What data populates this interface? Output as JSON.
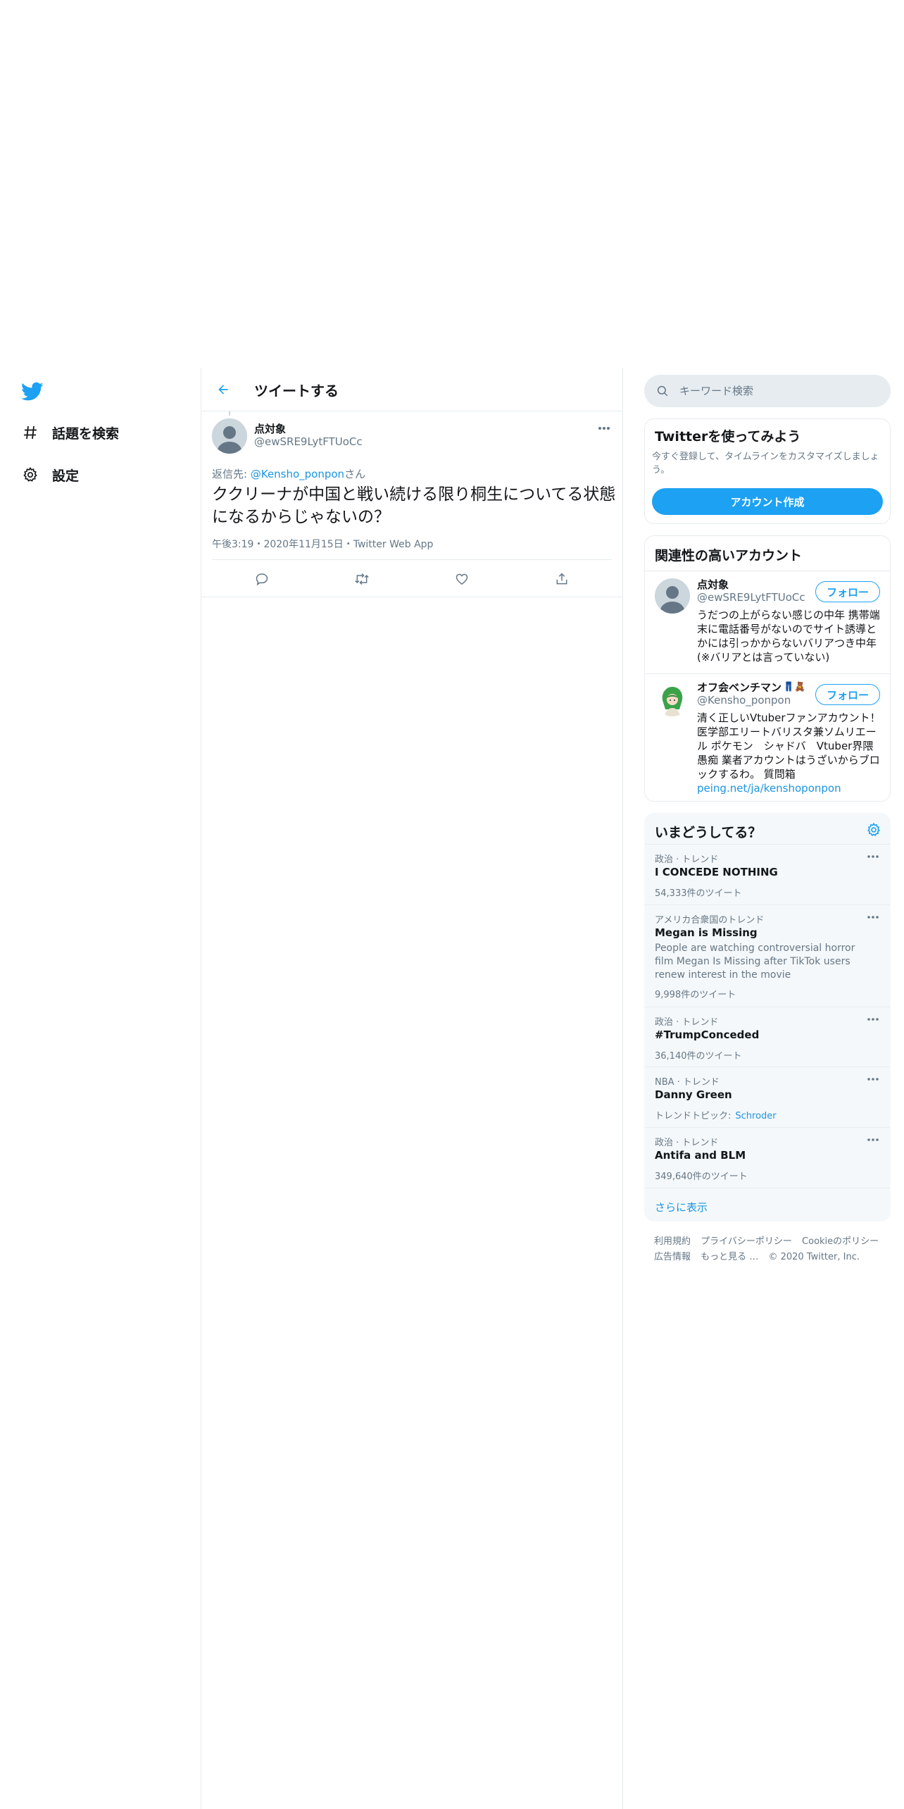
{
  "nav": {
    "items": [
      {
        "label": "話題を検索",
        "icon": "hashtag-icon"
      },
      {
        "label": "設定",
        "icon": "gear-icon"
      }
    ]
  },
  "header": {
    "title": "ツイートする"
  },
  "tweet": {
    "name": "点対象",
    "handle": "@ewSRE9LytFTUoCc",
    "reply_prefix": "返信先: ",
    "reply_mention": "@Kensho_ponpon",
    "reply_suffix": "さん",
    "text": "ククリーナが中国と戦い続ける限り桐生についてる状態になるからじゃないの？",
    "time": "午後3:19",
    "date": "2020年11月15日",
    "app": "Twitter Web App",
    "separator": "・"
  },
  "search": {
    "placeholder": "キーワード検索"
  },
  "signup": {
    "title": "Twitterを使ってみよう",
    "description": "今すぐ登録して、タイムラインをカスタマイズしましょう。",
    "button": "アカウント作成"
  },
  "who_to_follow": {
    "title": "関連性の高いアカウント",
    "accounts": [
      {
        "name": "点対象",
        "handle": "@ewSRE9LytFTUoCc",
        "follow_label": "フォロー",
        "bio": "うだつの上がらない感じの中年 携帯端末に電話番号がないのでサイト誘導とかには引っかからないバリアつき中年(※バリアとは言っていない)"
      },
      {
        "name": "オフ会ベンチマン",
        "emoji": "👖🧸",
        "handle": "@Kensho_ponpon",
        "follow_label": "フォロー",
        "bio": "清く正しいVtuberファンアカウント！医学部エリートバリスタ兼ソムリエール ポケモン　シャドバ　Vtuber界隈愚痴 業者アカウントはうざいからブロックするわ。 質問箱",
        "bio_link": "peing.net/ja/kenshoponpon"
      }
    ]
  },
  "trends": {
    "title": "いまどうしてる？",
    "items": [
      {
        "context": "政治 · トレンド",
        "name": "I CONCEDE NOTHING",
        "count": "54,333件のツイート"
      },
      {
        "context": "アメリカ合衆国のトレンド",
        "name": "Megan is Missing",
        "description": "People are watching controversial horror film Megan Is Missing after TikTok users renew interest in the movie",
        "count": "9,998件のツイート"
      },
      {
        "context": "政治 · トレンド",
        "name": "#TrumpConceded",
        "count": "36,140件のツイート"
      },
      {
        "context": "NBA · トレンド",
        "name": "Danny Green",
        "topic_label": "トレンドトピック:",
        "topic_link": "Schroder"
      },
      {
        "context": "政治 · トレンド",
        "name": "Antifa and BLM",
        "count": "349,640件のツイート"
      }
    ],
    "show_more": "さらに表示"
  },
  "footer": {
    "links": [
      "利用規約",
      "プライバシーポリシー",
      "Cookieのポリシー",
      "広告情報",
      "もっと見る …"
    ],
    "copyright": "© 2020 Twitter, Inc."
  },
  "colors": {
    "accent": "#1da1f2",
    "link": "#1b95e0",
    "muted": "#657786",
    "border": "#e6ecf0"
  }
}
